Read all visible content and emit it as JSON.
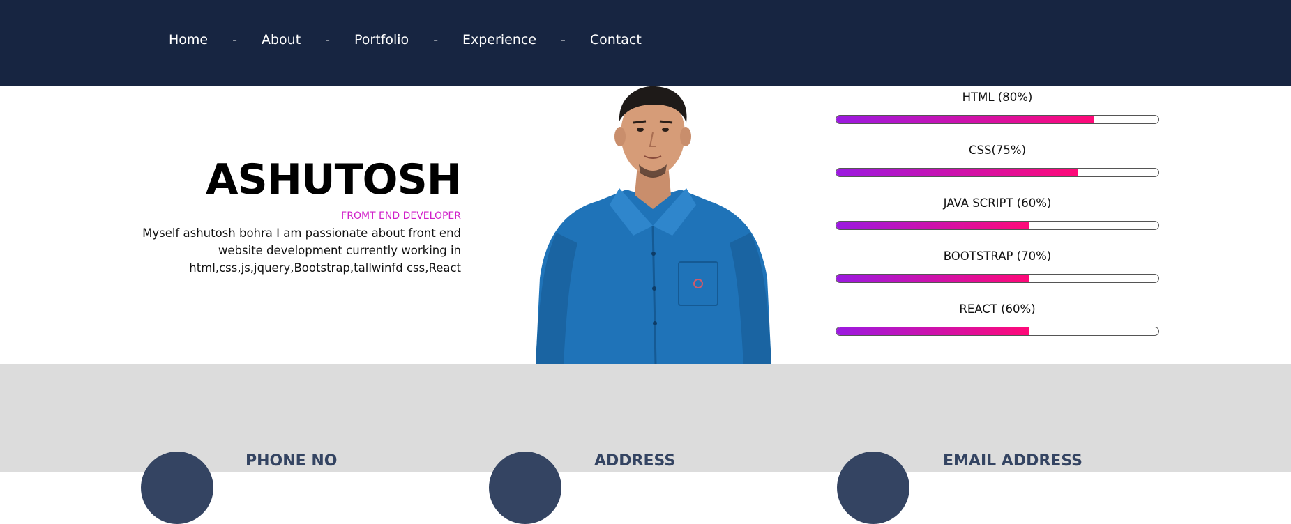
{
  "nav": {
    "items": [
      "Home",
      "About",
      "Portfolio",
      "Experience",
      "Contact"
    ],
    "separator": "-"
  },
  "hero": {
    "name": "ASHUTOSH",
    "role": "FROMT END DEVELOPER",
    "bio": "Myself ashutosh bohra I am passionate about front end website development currently working in html,css,js,jquery,Bootstrap,tallwinfd css,React"
  },
  "skills": [
    {
      "label": "HTML (80%)",
      "level": 0.8
    },
    {
      "label": "CSS(75%)",
      "level": 0.75
    },
    {
      "label": "JAVA SCRIPT (60%)",
      "level": 0.6
    },
    {
      "label": "BOOTSTRAP (70%)",
      "level": 0.6
    },
    {
      "label": "REACT (60%)",
      "level": 0.6
    }
  ],
  "contact": {
    "phone_title": "PHONE NO",
    "address_title": "ADDRESS",
    "email_title": "EMAIL ADDRESS"
  },
  "colors": {
    "navbar": "#172541",
    "accent_pink": "#d01fc9",
    "bar_start": "#9b1ae0",
    "bar_end": "#ff0a78",
    "contact_bg": "#dcdcdc",
    "contact_dark": "#344462"
  }
}
